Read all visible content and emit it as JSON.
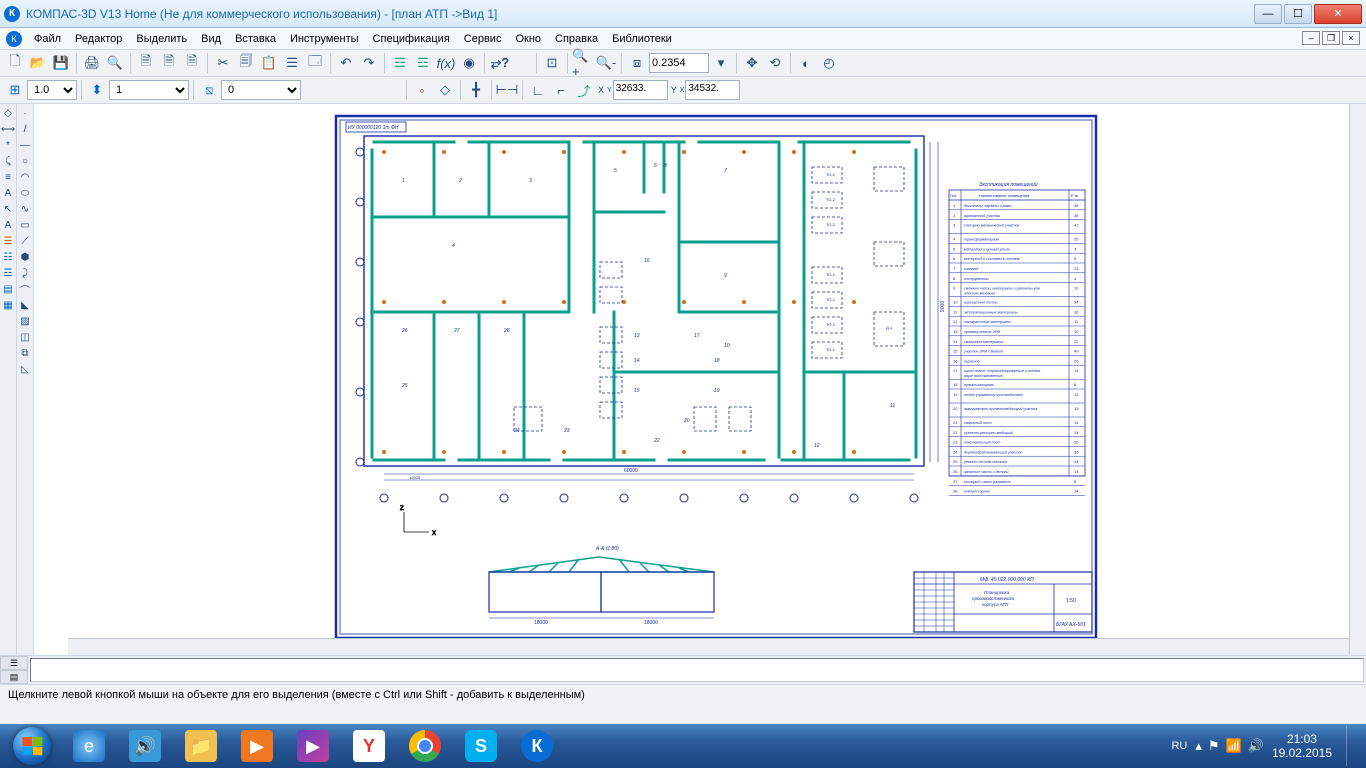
{
  "title": "КОМПАС-3D V13 Home (Не для коммерческого использования) - [план АТП ->Вид 1]",
  "menu": [
    "Файл",
    "Редактор",
    "Выделить",
    "Вид",
    "Вставка",
    "Инструменты",
    "Спецификация",
    "Сервис",
    "Окно",
    "Справка",
    "Библиотеки"
  ],
  "toolbar1": {
    "zoom_value": "0.2354"
  },
  "toolbar2": {
    "line_width": "1.0",
    "layer": "1",
    "style": "0",
    "x": "32633.",
    "y": "34532."
  },
  "status": "Щелкните левой кнопкой мыши на объекте для его выделения (вместе с Ctrl или Shift - добавить к выделенным)",
  "tray": {
    "lang": "RU"
  },
  "clock": {
    "time": "21:03",
    "date": "19.02.2015"
  },
  "drawing": {
    "stamp_code": "ИУ 000000120 1т ФН",
    "section_label": "А-А (1:80)",
    "table_title": "Экспликация помещений",
    "table_header": [
      "Поз.",
      "Наименование помещения",
      "P, м²"
    ],
    "table_rows": [
      [
        "1",
        "двигатели, карданы и рамы",
        "36"
      ],
      [
        "2",
        "агрегатный участок",
        "36"
      ],
      [
        "3",
        "слесарно-механический участок",
        "42"
      ],
      [
        "4",
        "трансформаторная",
        "20"
      ],
      [
        "5",
        "металлом и ценный утиль",
        "3"
      ],
      [
        "6",
        "моторный и системы в составе",
        "5"
      ],
      [
        "7",
        "главный",
        "13"
      ],
      [
        "8",
        "инструменты",
        "4"
      ],
      [
        "9",
        "сменные части, материалы и ремонты комплектно мехового",
        "10"
      ],
      [
        "10",
        "агрегатные посты",
        "54"
      ],
      [
        "11",
        "эксплуатационные материалы",
        "16"
      ],
      [
        "12",
        "лакокрасочные материалы",
        "11"
      ],
      [
        "13",
        "промежуточное ЭРМ",
        "10"
      ],
      [
        "14",
        "смазочные материалы",
        "22"
      ],
      [
        "15",
        "участок ЭРМ с мойкой",
        "49"
      ],
      [
        "16",
        "окрасной",
        "20"
      ],
      [
        "17",
        "шины новые, отремонтированные и подлежащие восстановлению",
        "14"
      ],
      [
        "18",
        "вулканизаторная",
        "8"
      ],
      [
        "19",
        "отдел управления производством",
        "12"
      ],
      [
        "20",
        "аккумулятрно-кузнечномедницкий участок",
        "13"
      ],
      [
        "21",
        "сварочный пост",
        "14"
      ],
      [
        "22",
        "кузнечно-рессорно-медицкий",
        "24"
      ],
      [
        "23",
        "локстекольный пост",
        "30"
      ],
      [
        "24",
        "деревообрабатывающий участок",
        "36"
      ],
      [
        "25",
        "ремонт систем питания",
        "34"
      ],
      [
        "26",
        "запасные части и детали",
        "14"
      ],
      [
        "27",
        "кислород и азот-развозные",
        "6"
      ],
      [
        "28",
        "компрессорная",
        "34"
      ]
    ],
    "title_block": {
      "code": "МФ. 45.022.000.000 КП",
      "name_line1": "Планировка",
      "name_line2": "производственного",
      "name_line3": "корпуса АТП",
      "sheet": "1:50",
      "org": "БГАУ  АХ-501"
    }
  }
}
